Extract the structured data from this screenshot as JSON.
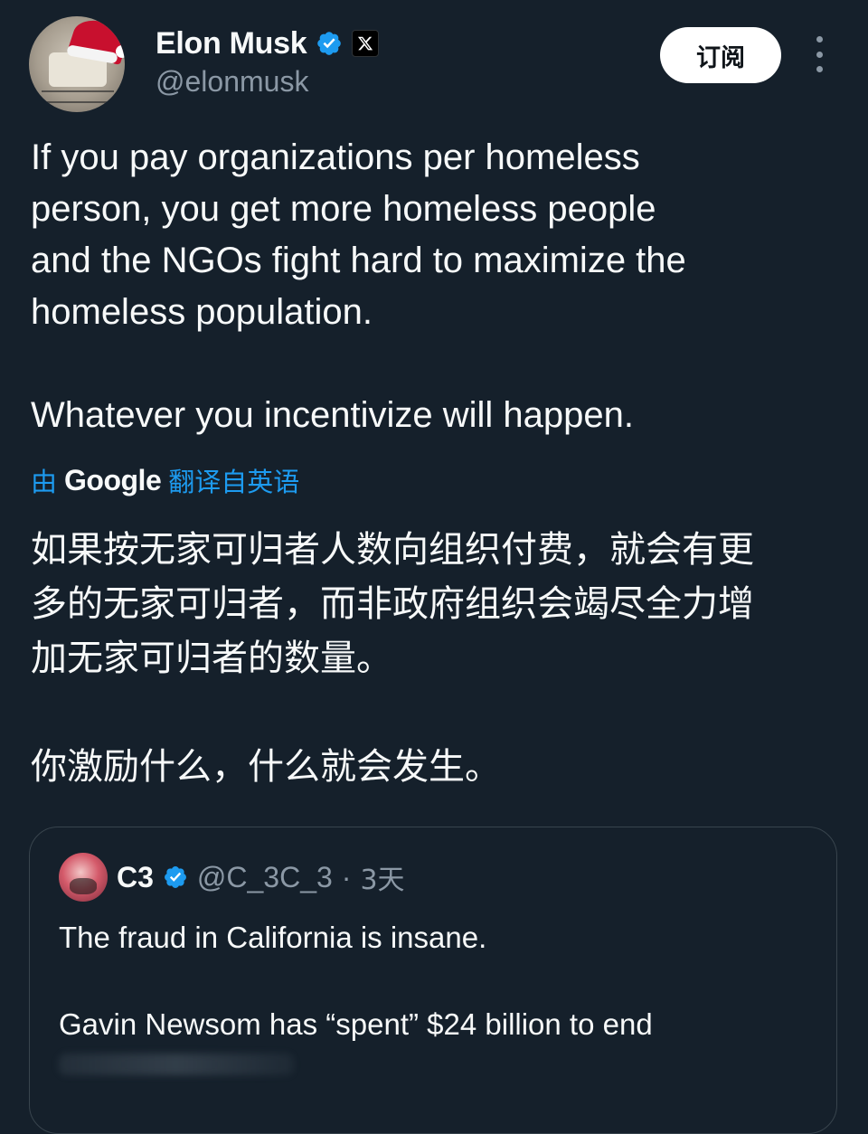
{
  "author": {
    "display_name": "Elon Musk",
    "handle": "@elonmusk",
    "verified": true,
    "affiliation_badge": "x-logo-icon"
  },
  "actions": {
    "subscribe_label": "订阅",
    "more_icon": "more-vertical-icon"
  },
  "tweet": {
    "text": "If you pay organizations per homeless\nperson, you get more homeless people\nand the NGOs fight hard to maximize the\nhomeless population.\n\nWhatever you incentivize will happen."
  },
  "translation": {
    "prefix": "由",
    "provider": "Google",
    "suffix": "翻译自英语",
    "text": "如果按无家可归者人数向组织付费，就会有更\n多的无家可归者，而非政府组织会竭尽全力增\n加无家可归者的数量。\n\n你激励什么，什么就会发生。"
  },
  "quoted_tweet": {
    "display_name": "C3",
    "handle": "@C_3C_3",
    "separator": "·",
    "time": "3天",
    "verified": true,
    "text": "The fraud in California is insane.\n\nGavin Newsom has “spent” $24 billion to end"
  },
  "colors": {
    "background": "#15202b",
    "text_primary": "#f7f9f9",
    "text_secondary": "#8b98a5",
    "accent": "#1d9bf0",
    "border": "#38444d"
  }
}
